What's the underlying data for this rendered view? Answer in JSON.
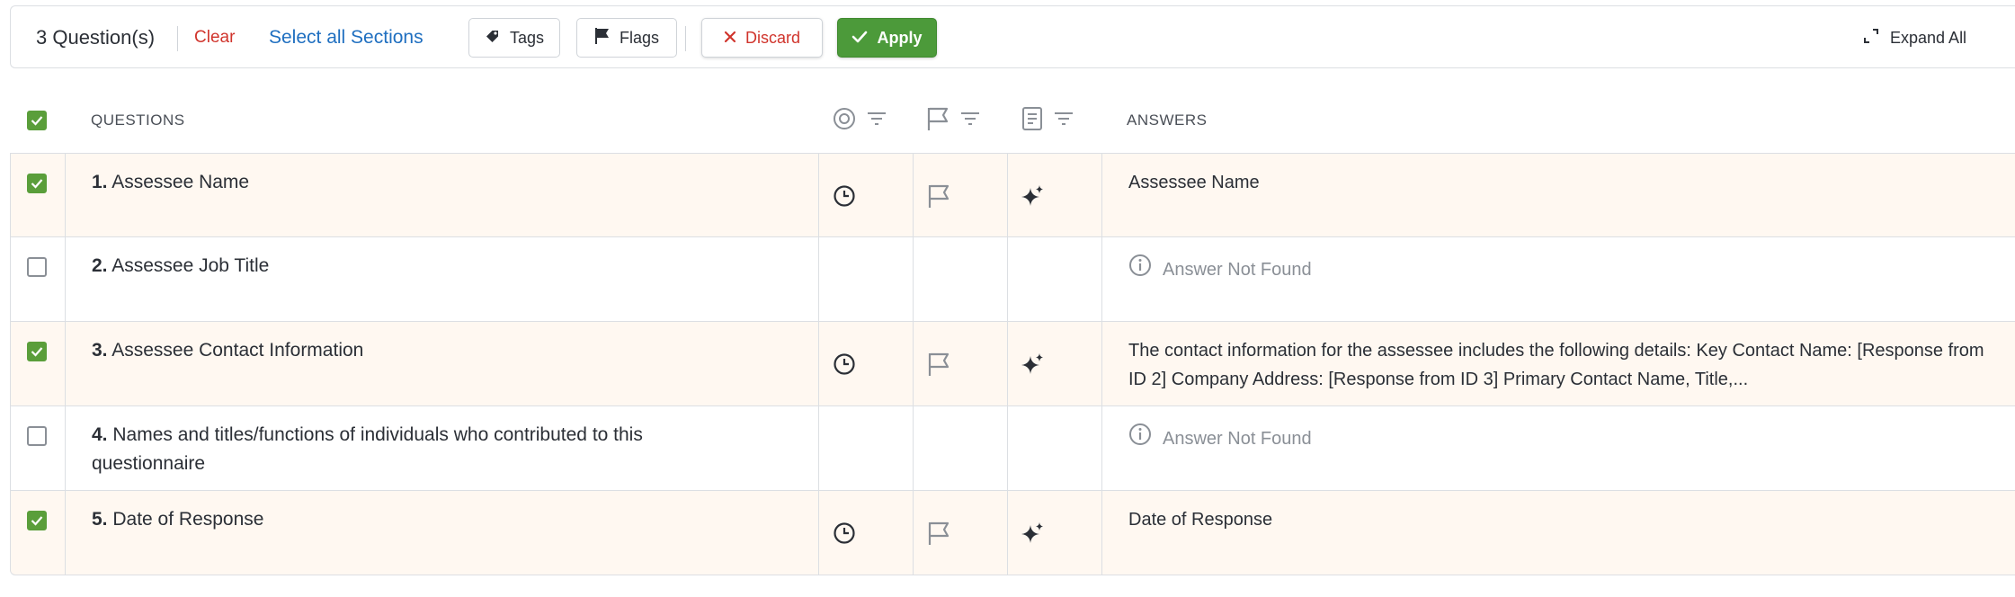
{
  "toolbar": {
    "question_count": "3 Question(s)",
    "clear_label": "Clear",
    "select_all_label": "Select all Sections",
    "tags_label": "Tags",
    "flags_label": "Flags",
    "discard_label": "Discard",
    "apply_label": "Apply",
    "expand_all_label": "Expand All"
  },
  "table": {
    "headers": {
      "questions": "QUESTIONS",
      "answers": "ANSWERS"
    },
    "rows": [
      {
        "number": "1.",
        "question": "Assessee Name",
        "answer": "Assessee Name",
        "checked": true
      },
      {
        "number": "2.",
        "question": "Assessee Job Title",
        "answer": "Answer Not Found",
        "checked": false
      },
      {
        "number": "3.",
        "question": "Assessee Contact Information",
        "answer": "The contact information for the assessee includes the following details: Key Contact Name: [Response from ID 2] Company Address: [Response from ID 3] Primary Contact Name, Title,...",
        "checked": true
      },
      {
        "number": "4.",
        "question": "Names and titles/functions of individuals who contributed to this questionnaire",
        "answer": "Answer Not Found",
        "checked": false
      },
      {
        "number": "5.",
        "question": "Date of Response",
        "answer": "Date of Response",
        "checked": true
      }
    ]
  },
  "colors": {
    "accent_green": "#4c9a3a",
    "danger_red": "#d0342c",
    "link_blue": "#1f6fc0",
    "selected_row_bg": "#fff8f1"
  }
}
